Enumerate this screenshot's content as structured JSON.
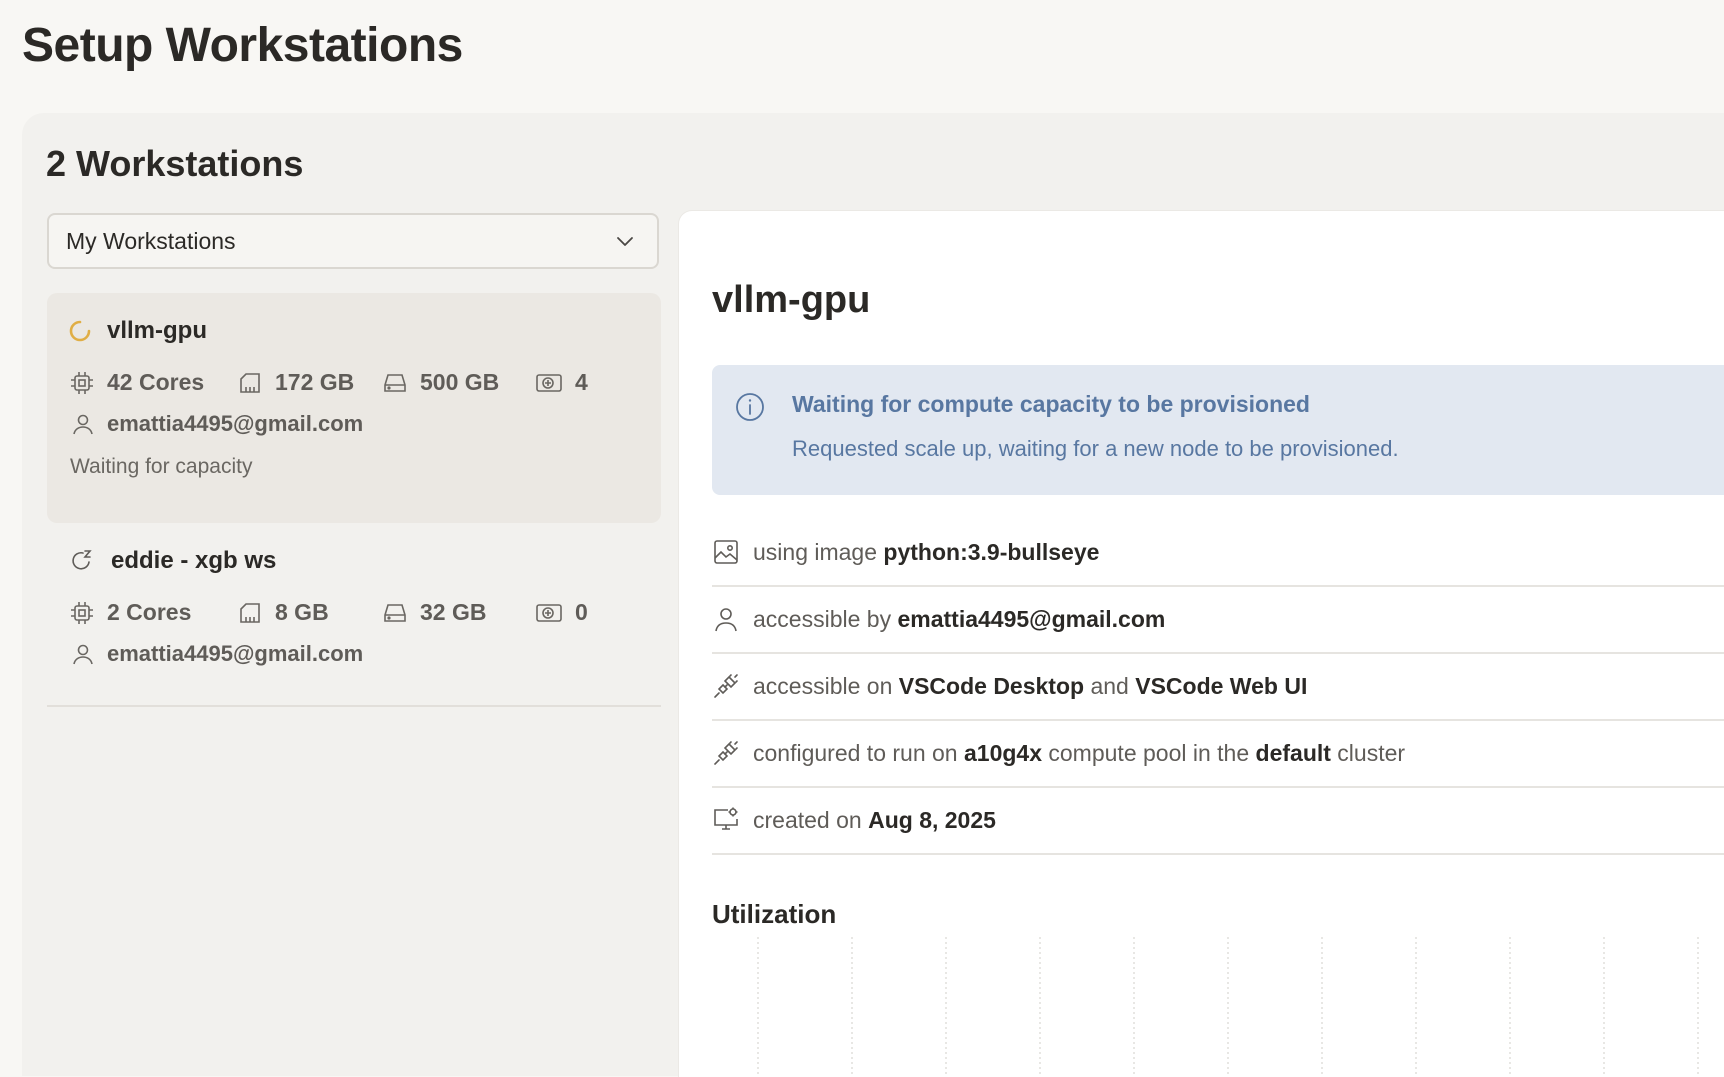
{
  "page": {
    "title": "Setup Workstations"
  },
  "panel": {
    "title": "2 Workstations",
    "filter_dropdown": {
      "selected": "My Workstations",
      "icon": "chevron-down-icon"
    }
  },
  "workstations": [
    {
      "name": "vllm-gpu",
      "status_icon": "loading-spinner-icon",
      "status_color": "#e0ae45",
      "cores": "42 Cores",
      "memory": "172 GB",
      "disk": "500 GB",
      "gpus": "4",
      "owner": "emattia4495@gmail.com",
      "status_text": "Waiting for capacity",
      "selected": true
    },
    {
      "name": "eddie - xgb ws",
      "status_icon": "sleep-refresh-icon",
      "cores": "2 Cores",
      "memory": "8 GB",
      "disk": "32 GB",
      "gpus": "0",
      "owner": "emattia4495@gmail.com",
      "selected": false
    }
  ],
  "detail": {
    "title": "vllm-gpu",
    "alert": {
      "title": "Waiting for compute capacity to be provisioned",
      "body": "Requested scale up, waiting for a new node to be provisioned.",
      "color": "#5877a1",
      "background": "#e2e8f1"
    },
    "rows": {
      "image": {
        "prefix": "using image ",
        "value": "python:3.9-bullseye"
      },
      "access": {
        "prefix": "accessible by ",
        "value": "emattia4495@gmail.com"
      },
      "ide": {
        "prefix": "accessible on ",
        "ide1": "VSCode Desktop",
        "joiner": " and ",
        "ide2": "VSCode Web UI"
      },
      "compute": {
        "prefix": "configured to run on ",
        "pool": "a10g4x",
        "middle": " compute pool in the ",
        "cluster": "default",
        "suffix": " cluster"
      },
      "created": {
        "prefix": "created on ",
        "value": "Aug 8, 2025"
      }
    },
    "utilization": {
      "title": "Utilization"
    }
  }
}
